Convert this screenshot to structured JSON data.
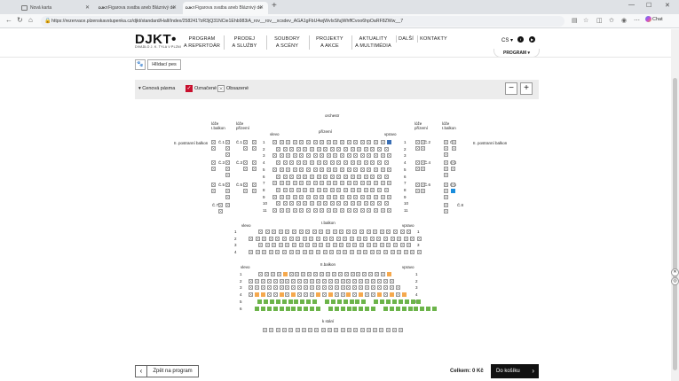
{
  "browser": {
    "tabs": [
      {
        "title": "Nová karta"
      },
      {
        "title": "Figarova svatba aneb Bláznivý de"
      },
      {
        "title": "Figarova svatba aneb Bláznivý de"
      }
    ],
    "url": "https://rezervace.plzenskavstupenka.cz/djkt/standard/Hall/Index/258241?zR3jQ31NCie1Ehb983iA_rov__rov__xcsdev_AGA1gFbU4wjWvIsSfujWhffCvoo6hpOaRF8ZWw__7",
    "chat_label": "Chat",
    "fav_text": "DJKT"
  },
  "site": {
    "logo": "DJKT•",
    "logo_sub": "DIVADLO J. K. TYLA V PLZNI",
    "nav": [
      {
        "l1": "PROGRAM",
        "l2": "A REPERTOÁR"
      },
      {
        "l1": "PRODEJ",
        "l2": "A SLUŽBY"
      },
      {
        "l1": "SOUBORY",
        "l2": "A SCÉNY"
      },
      {
        "l1": "PROJEKTY",
        "l2": "A AKCE"
      },
      {
        "l1": "AKTUALITY",
        "l2": "A MULTIMÉDIA"
      },
      {
        "l1": "DALŠÍ",
        "l2": ""
      },
      {
        "l1": "KONTAKTY",
        "l2": ""
      }
    ],
    "lang": "CS ▾",
    "program_btn": "PROGRAM ▾"
  },
  "content": {
    "dog_label": "Hlídací pes",
    "price_zones_label": "Cenová pásma",
    "marked_label": "Označené",
    "occupied_label": "Obsazené",
    "minus": "−",
    "plus": "+"
  },
  "seatmap": {
    "labels": {
      "orchestra": "orchestr",
      "left_side": "vlevo",
      "ground_floor": "přízemí",
      "right_side": "vpravo",
      "box_1_balcony": "lóže\nI.balkon",
      "box_ground": "lóže\npřízemí",
      "second_balcony_left": "II. postranní balkon",
      "second_balcony_right": "II. postranní balkon",
      "first_balcony": "I.balkon",
      "second_balcony": "II.balkon",
      "standing": "k stání"
    },
    "box_labels_left": [
      "Č.1",
      "Č.1",
      "Č.3",
      "Č.3",
      "Č.5",
      "Č.5",
      "Č.7"
    ],
    "box_labels_right": [
      "Č.2",
      "Č.2",
      "Č.4",
      "Č.4",
      "Č.6",
      "Č.6",
      "Č.8"
    ],
    "row_numbers_ground": [
      "1",
      "2",
      "3",
      "4",
      "5",
      "6",
      "7",
      "8",
      "9",
      "10",
      "11"
    ],
    "row_numbers_balcony1": [
      "1",
      "2",
      "3",
      "4"
    ],
    "row_numbers_balcony2": [
      "1",
      "2",
      "3",
      "4",
      "5",
      "6"
    ],
    "legend_colors": {
      "orange": "#f5a94e",
      "green": "#6cb44a",
      "blue": "#3a6fb5",
      "marked": "#c8102e"
    }
  },
  "footer": {
    "back_label": "Zpět na program",
    "back_icon": "chevron-left-icon",
    "total_label": "Celkem: 0 Kč",
    "cart_label": "Do košíku",
    "cart_icon": "chevron-right-icon"
  }
}
